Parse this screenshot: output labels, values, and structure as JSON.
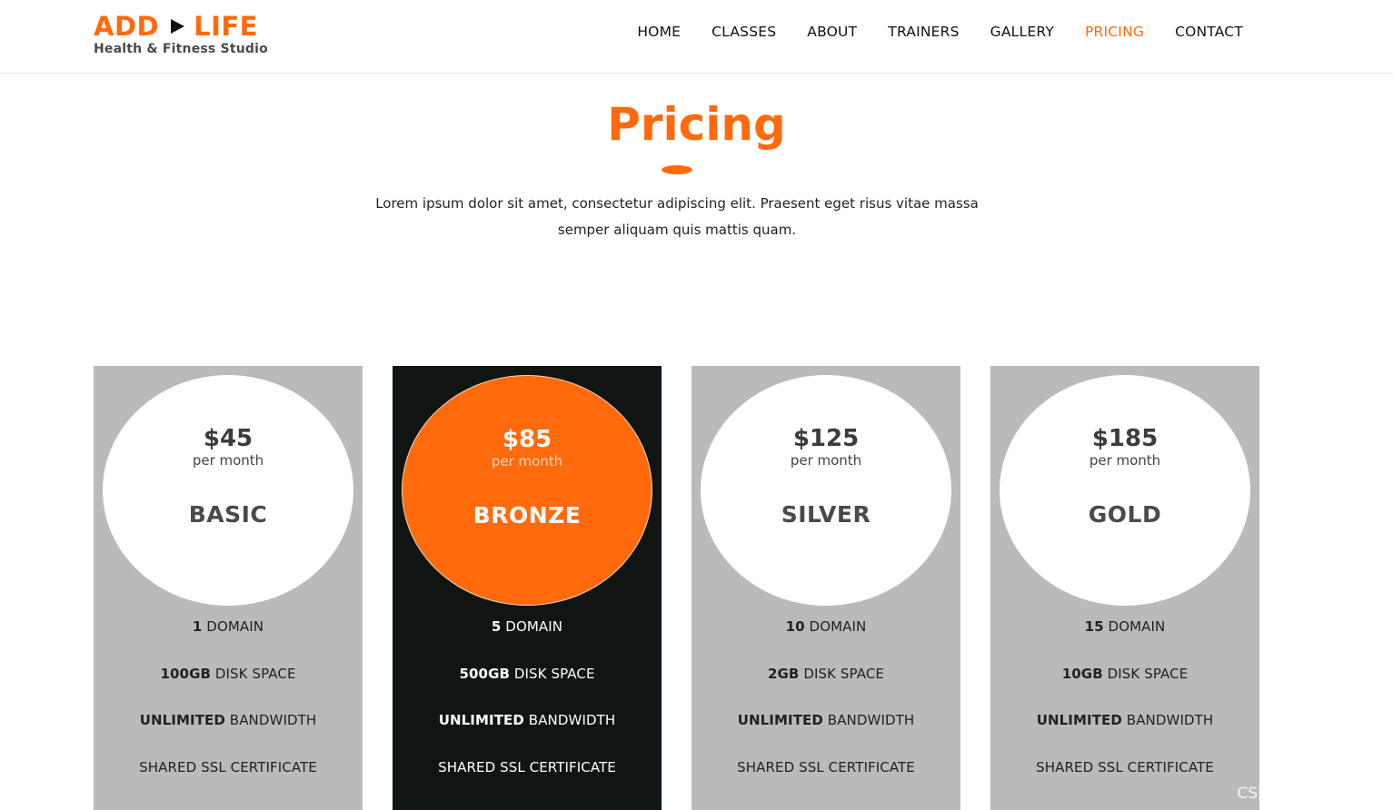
{
  "header": {
    "logo_main_left": "ADD",
    "logo_main_right": "LIFE",
    "logo_sub": "Health & Fitness Studio",
    "nav": [
      {
        "label": "HOME"
      },
      {
        "label": "CLASSES"
      },
      {
        "label": "ABOUT"
      },
      {
        "label": "TRAINERS"
      },
      {
        "label": "GALLERY"
      },
      {
        "label": "PRICING",
        "active": true
      },
      {
        "label": "CONTACT"
      }
    ]
  },
  "section": {
    "title": "Pricing",
    "description": "Lorem ipsum dolor sit amet, consectetur adipiscing elit. Praesent eget risus vitae massa semper aliquam quis mattis quam."
  },
  "plans": [
    {
      "price": "$45",
      "period": "per month",
      "name": "BASIC",
      "features": [
        {
          "bold": "1",
          "text": " DOMAIN"
        },
        {
          "bold": "100GB",
          "text": " DISK SPACE"
        },
        {
          "bold": "UNLIMITED",
          "text": " BANDWIDTH"
        },
        {
          "bold": "",
          "text": "SHARED SSL CERTIFICATE"
        }
      ]
    },
    {
      "price": "$85",
      "period": "per month",
      "name": "BRONZE",
      "featured": true,
      "features": [
        {
          "bold": "5",
          "text": " DOMAIN"
        },
        {
          "bold": "500GB",
          "text": " DISK SPACE"
        },
        {
          "bold": "UNLIMITED",
          "text": " BANDWIDTH"
        },
        {
          "bold": "",
          "text": "SHARED SSL CERTIFICATE"
        }
      ]
    },
    {
      "price": "$125",
      "period": "per month",
      "name": "SILVER",
      "features": [
        {
          "bold": "10",
          "text": " DOMAIN"
        },
        {
          "bold": "2GB",
          "text": " DISK SPACE"
        },
        {
          "bold": "UNLIMITED",
          "text": " BANDWIDTH"
        },
        {
          "bold": "",
          "text": "SHARED SSL CERTIFICATE"
        }
      ]
    },
    {
      "price": "$185",
      "period": "per month",
      "name": "GOLD",
      "features": [
        {
          "bold": "15",
          "text": " DOMAIN"
        },
        {
          "bold": "10GB",
          "text": " DISK SPACE"
        },
        {
          "bold": "UNLIMITED",
          "text": " BANDWIDTH"
        },
        {
          "bold": "",
          "text": "SHARED SSL CERTIFICATE"
        }
      ]
    }
  ],
  "watermark": "CSDN @java李杨勇",
  "colors": {
    "accent": "#ff6a0c",
    "card_bg": "#bbb9bb",
    "featured_bg": "#111512"
  }
}
